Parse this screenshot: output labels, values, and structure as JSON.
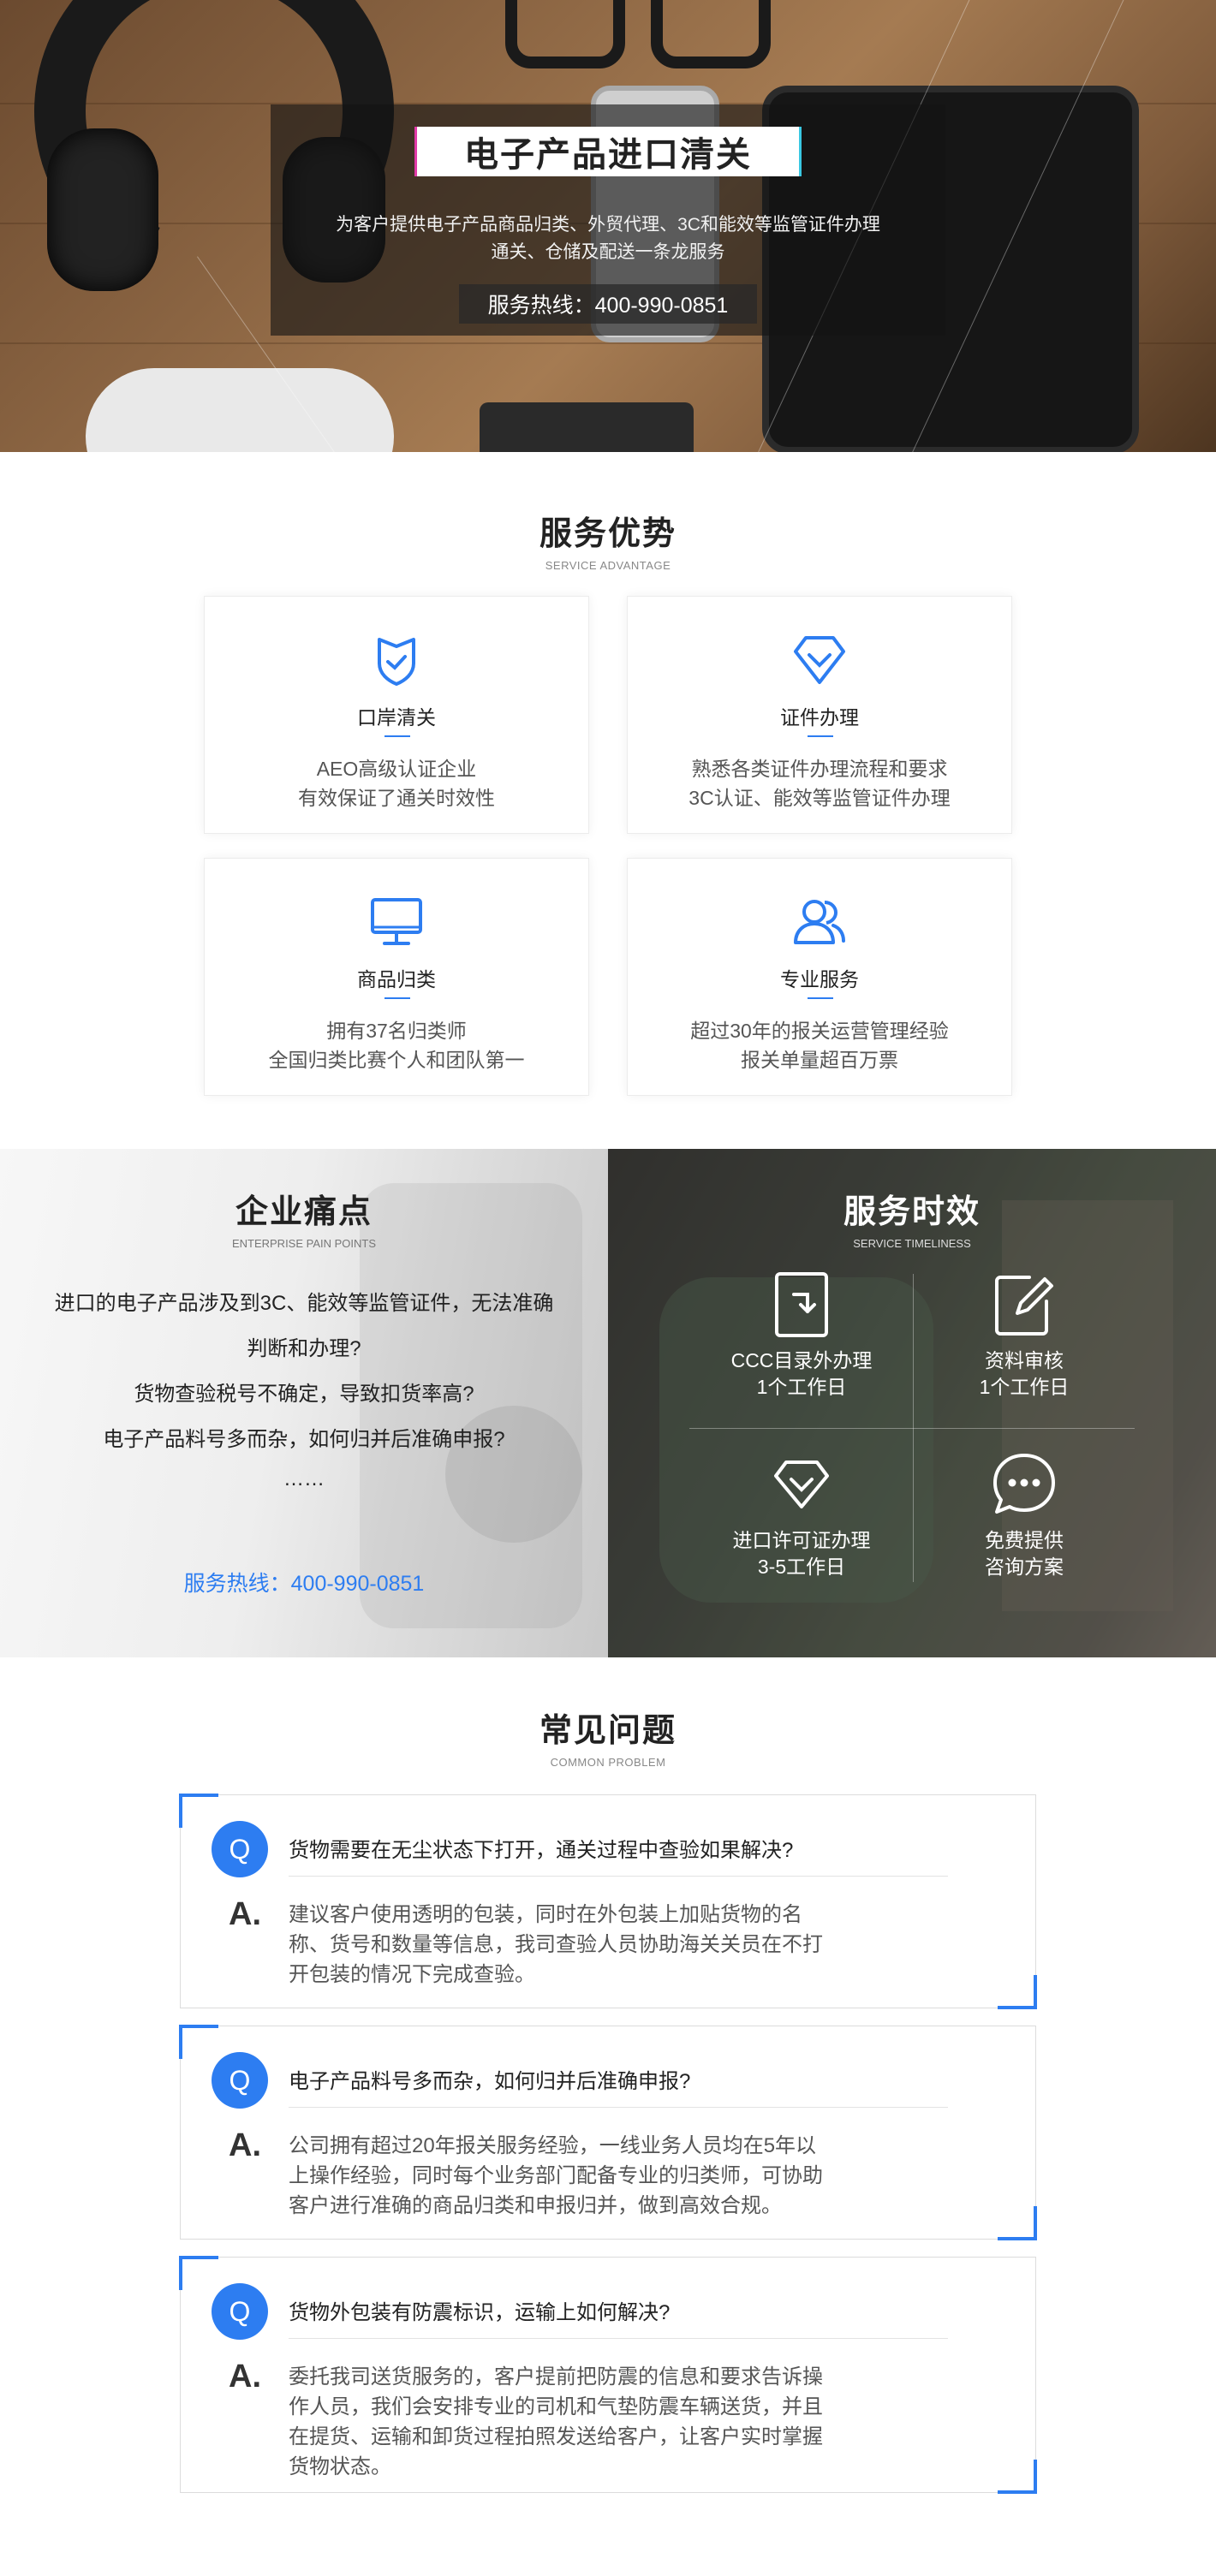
{
  "hero": {
    "title": "电子产品进口清关",
    "subtitle_line1": "为客户提供电子产品商品归类、外贸代理、3C和能效等监管证件办理",
    "subtitle_line2": "通关、仓储及配送一条龙服务",
    "hotline": "服务热线：400-990-0851"
  },
  "advantage": {
    "title": "服务优势",
    "subtitle": "SERVICE ADVANTAGE",
    "cards": [
      {
        "icon": "shield-check-icon",
        "title": "口岸清关",
        "line1": "AEO高级认证企业",
        "line2": "有效保证了通关时效性"
      },
      {
        "icon": "diamond-icon",
        "title": "证件办理",
        "line1": "熟悉各类证件办理流程和要求",
        "line2": "3C认证、能效等监管证件办理"
      },
      {
        "icon": "monitor-icon",
        "title": "商品归类",
        "line1": "拥有37名归类师",
        "line2": "全国归类比赛个人和团队第一"
      },
      {
        "icon": "users-icon",
        "title": "专业服务",
        "line1": "超过30年的报关运营管理经验",
        "line2": "报关单量超百万票"
      }
    ]
  },
  "pain": {
    "title": "企业痛点",
    "subtitle": "ENTERPRISE PAIN POINTS",
    "lines": [
      "进口的电子产品涉及到3C、能效等监管证件，无法准确",
      "判断和办理?",
      "货物查验税号不确定，导致扣货率高?",
      "电子产品料号多而杂，如何归并后准确申报?",
      "……"
    ],
    "hotline": "服务热线：400-990-0851"
  },
  "timeliness": {
    "title": "服务时效",
    "subtitle": "SERVICE TIMELINESS",
    "items": [
      {
        "icon": "document-arrow-icon",
        "line1": "CCC目录外办理",
        "line2": "1个工作日"
      },
      {
        "icon": "edit-icon",
        "line1": "资料审核",
        "line2": "1个工作日"
      },
      {
        "icon": "diamond-icon",
        "line1": "进口许可证办理",
        "line2": "3-5工作日"
      },
      {
        "icon": "chat-bubble-icon",
        "line1": "免费提供",
        "line2": "咨询方案"
      }
    ]
  },
  "faq": {
    "title": "常见问题",
    "subtitle": "COMMON PROBLEM",
    "q_mark": "Q",
    "a_mark": "A.",
    "items": [
      {
        "question": "货物需要在无尘状态下打开，通关过程中查验如果解决?",
        "answer_lines": [
          "建议客户使用透明的包装，同时在外包装上加贴货物的名",
          "称、货号和数量等信息，我司查验人员协助海关关员在不打",
          "开包装的情况下完成查验。"
        ]
      },
      {
        "question": "电子产品料号多而杂，如何归并后准确申报?",
        "answer_lines": [
          "公司拥有超过20年报关服务经验，一线业务人员均在5年以",
          "上操作经验，同时每个业务部门配备专业的归类师，可协助",
          "客户进行准确的商品归类和申报归并，做到高效合规。"
        ]
      },
      {
        "question": "货物外包装有防震标识，运输上如何解决?",
        "answer_lines": [
          "委托我司送货服务的，客户提前把防震的信息和要求告诉操",
          "作人员，我们会安排专业的司机和气垫防震车辆送货，并且",
          "在提货、运输和卸货过程拍照发送给客户，让客户实时掌握",
          "货物状态。"
        ]
      }
    ]
  },
  "colors": {
    "accent": "#2d7df1",
    "title_text": "#222222",
    "body_text": "#555555"
  }
}
